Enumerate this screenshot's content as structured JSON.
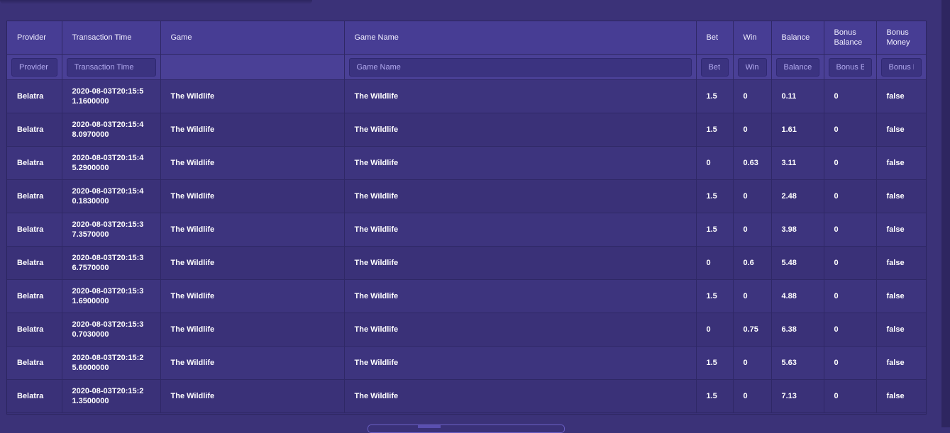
{
  "columns": [
    {
      "key": "provider",
      "label": "Provider",
      "placeholder": "Provider"
    },
    {
      "key": "time",
      "label": "Transaction Time",
      "placeholder": "Transaction Time"
    },
    {
      "key": "game",
      "label": "Game",
      "placeholder": ""
    },
    {
      "key": "game_name",
      "label": "Game Name",
      "placeholder": "Game Name"
    },
    {
      "key": "bet",
      "label": "Bet",
      "placeholder": "Bet"
    },
    {
      "key": "win",
      "label": "Win",
      "placeholder": "Win"
    },
    {
      "key": "balance",
      "label": "Balance",
      "placeholder": "Balance"
    },
    {
      "key": "bonus_balance",
      "label": "Bonus Balance",
      "placeholder": "Bonus Balance"
    },
    {
      "key": "bonus_money",
      "label": "Bonus Money",
      "placeholder": "Bonus Money"
    }
  ],
  "rows": [
    {
      "provider": "Belatra",
      "time": "2020-08-03T20:15:51.1600000",
      "game": "The Wildlife",
      "game_name": "The Wildlife",
      "bet": "1.5",
      "win": "0",
      "balance": "0.11",
      "bonus_balance": "0",
      "bonus_money": "false"
    },
    {
      "provider": "Belatra",
      "time": "2020-08-03T20:15:48.0970000",
      "game": "The Wildlife",
      "game_name": "The Wildlife",
      "bet": "1.5",
      "win": "0",
      "balance": "1.61",
      "bonus_balance": "0",
      "bonus_money": "false"
    },
    {
      "provider": "Belatra",
      "time": "2020-08-03T20:15:45.2900000",
      "game": "The Wildlife",
      "game_name": "The Wildlife",
      "bet": "0",
      "win": "0.63",
      "balance": "3.11",
      "bonus_balance": "0",
      "bonus_money": "false"
    },
    {
      "provider": "Belatra",
      "time": "2020-08-03T20:15:40.1830000",
      "game": "The Wildlife",
      "game_name": "The Wildlife",
      "bet": "1.5",
      "win": "0",
      "balance": "2.48",
      "bonus_balance": "0",
      "bonus_money": "false"
    },
    {
      "provider": "Belatra",
      "time": "2020-08-03T20:15:37.3570000",
      "game": "The Wildlife",
      "game_name": "The Wildlife",
      "bet": "1.5",
      "win": "0",
      "balance": "3.98",
      "bonus_balance": "0",
      "bonus_money": "false"
    },
    {
      "provider": "Belatra",
      "time": "2020-08-03T20:15:36.7570000",
      "game": "The Wildlife",
      "game_name": "The Wildlife",
      "bet": "0",
      "win": "0.6",
      "balance": "5.48",
      "bonus_balance": "0",
      "bonus_money": "false"
    },
    {
      "provider": "Belatra",
      "time": "2020-08-03T20:15:31.6900000",
      "game": "The Wildlife",
      "game_name": "The Wildlife",
      "bet": "1.5",
      "win": "0",
      "balance": "4.88",
      "bonus_balance": "0",
      "bonus_money": "false"
    },
    {
      "provider": "Belatra",
      "time": "2020-08-03T20:15:30.7030000",
      "game": "The Wildlife",
      "game_name": "The Wildlife",
      "bet": "0",
      "win": "0.75",
      "balance": "6.38",
      "bonus_balance": "0",
      "bonus_money": "false"
    },
    {
      "provider": "Belatra",
      "time": "2020-08-03T20:15:25.6000000",
      "game": "The Wildlife",
      "game_name": "The Wildlife",
      "bet": "1.5",
      "win": "0",
      "balance": "5.63",
      "bonus_balance": "0",
      "bonus_money": "false"
    },
    {
      "provider": "Belatra",
      "time": "2020-08-03T20:15:21.3500000",
      "game": "The Wildlife",
      "game_name": "The Wildlife",
      "bet": "1.5",
      "win": "0",
      "balance": "7.13",
      "bonus_balance": "0",
      "bonus_money": "false"
    }
  ],
  "colors": {
    "background": "#3b3278",
    "header": "#473d94",
    "filter_input": "#3b3380",
    "border": "#2f2866"
  }
}
